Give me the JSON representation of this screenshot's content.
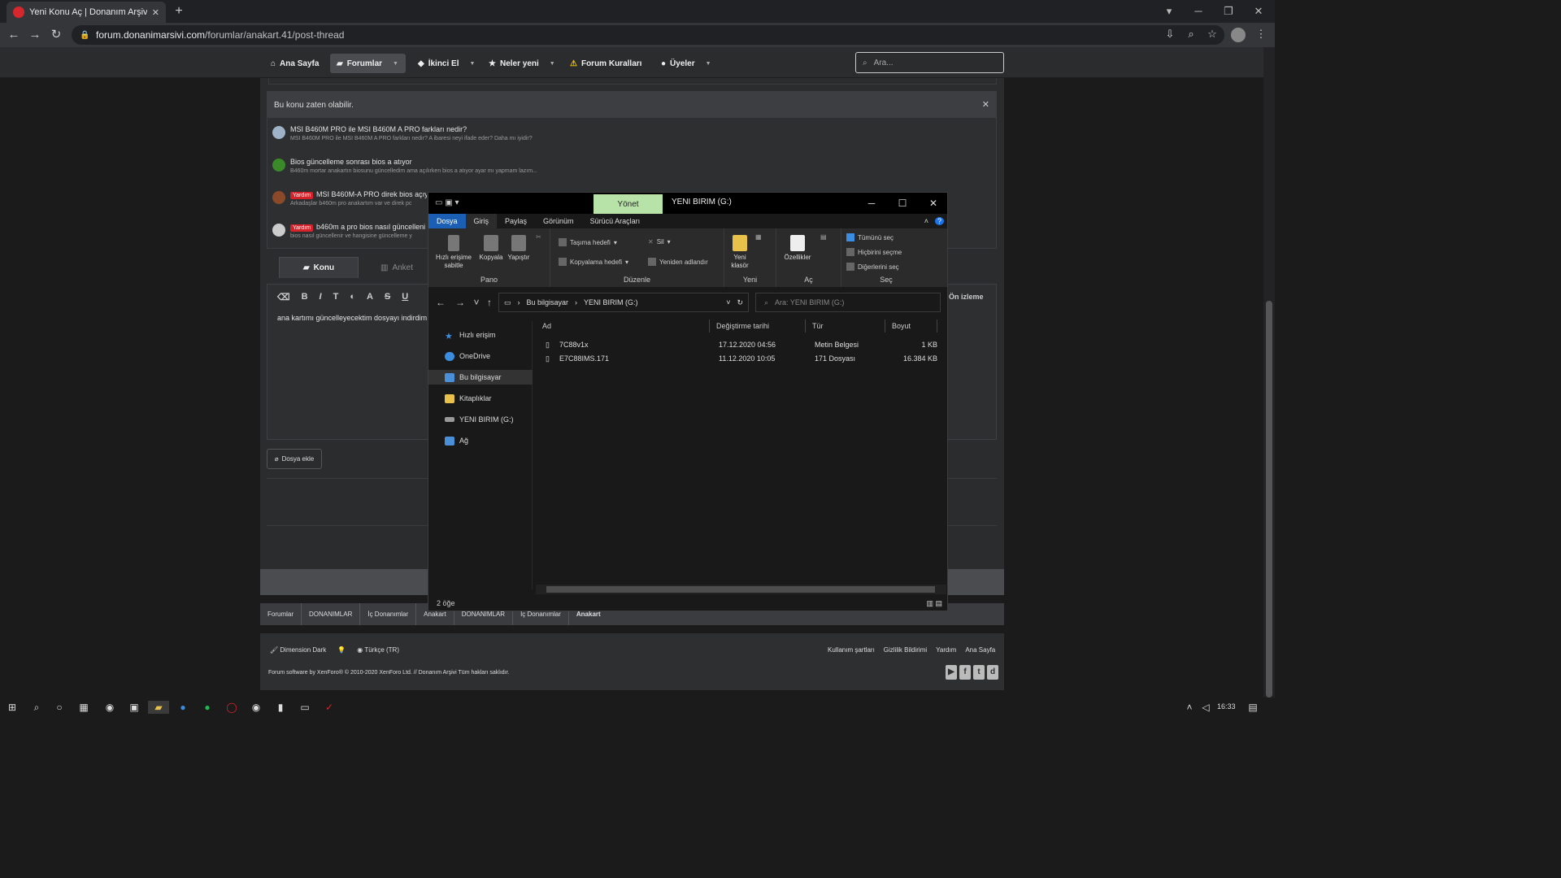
{
  "browser": {
    "tab_title": "Yeni Konu Aç | Donanım Arşivi Fo",
    "url_host": "forum.donanimarsivi.com",
    "url_path": "/forumlar/anakart.41/post-thread"
  },
  "nav": {
    "items": [
      "Ana Sayfa",
      "Forumlar",
      "İkinci El",
      "Neler yeni",
      "Forum Kuralları",
      "Üyeler"
    ],
    "search_placeholder": "Ara..."
  },
  "similar": {
    "header": "Bu konu zaten olabilir.",
    "items": [
      {
        "title": "MSI B460M PRO ile MSI B460M A PRO farkları nedir?",
        "snippet": "MSI B460M PRO ile MSI B460M A PRO farkları nedir? A ibaresi neyi ifade eder? Daha mı iyidir?",
        "badge": ""
      },
      {
        "title": "Bios güncelleme sonrası bios a atıyor",
        "snippet": "B460m mortar anakartın biosunu güncelledim ama açılırken bios a atıyor ayar mı yapmam lazım...",
        "badge": ""
      },
      {
        "title": "MSI B460M-A PRO direk bios açıy",
        "snippet": "Arkadaşlar b460m pro anakartım var ve direk pc",
        "badge": "Yardım"
      },
      {
        "title": "b460m a pro bios nasıl güncelleni",
        "snippet": "bios nasıl güncellenir ve hangisine güncelleme y",
        "badge": "Yardım"
      }
    ]
  },
  "tabs": {
    "konu": "Konu",
    "anket": "Anket"
  },
  "editor": {
    "text": "ana kartımı güncelleyecektim dosyayı indirdim",
    "preview": "Ön izleme"
  },
  "attach_label": "Dosya ekle",
  "breadcrumbs": [
    "Forumlar",
    "DONANIMLAR",
    "İç Donanımlar",
    "Anakart",
    "DONANIMLAR",
    "İç Donanımlar",
    "Anakart"
  ],
  "footer": {
    "style": "Dimension Dark",
    "lang": "Türkçe (TR)",
    "links": [
      "Kullanım şartları",
      "Gizlilik Bildirimi",
      "Yardım",
      "Ana Sayfa"
    ],
    "copyright": "Forum software by XenForo® © 2010-2020 XenForo Ltd.   //   Donanım Arşivi Tüm hakları saklıdır."
  },
  "explorer": {
    "manage_tab": "Yönet",
    "title": "YENI BIRIM (G:)",
    "ribbon_tabs": [
      "Dosya",
      "Giriş",
      "Paylaş",
      "Görünüm",
      "Sürücü Araçları"
    ],
    "ribbon": {
      "pin": "Hızlı erişime sabitle",
      "copy": "Kopyala",
      "paste": "Yapıştır",
      "move_to": "Taşıma hedefi",
      "copy_to": "Kopyalama hedefi",
      "delete": "Sil",
      "rename": "Yeniden adlandır",
      "new_folder": "Yeni klasör",
      "properties": "Özellikler",
      "select_all": "Tümünü seç",
      "select_none": "Hiçbirini seçme",
      "invert": "Diğerlerini seç"
    },
    "groups": [
      "Pano",
      "Düzenle",
      "Yeni",
      "Aç",
      "Seç"
    ],
    "path": [
      "Bu bilgisayar",
      "YENI BIRIM (G:)"
    ],
    "search_placeholder": "Ara: YENI BIRIM (G:)",
    "sidebar": [
      "Hızlı erişim",
      "OneDrive",
      "Bu bilgisayar",
      "Kitaplıklar",
      "YENI BIRIM (G:)",
      "Ağ"
    ],
    "columns": [
      "Ad",
      "Değiştirme tarihi",
      "Tür",
      "Boyut"
    ],
    "files": [
      {
        "name": "7C88v1x",
        "date": "17.12.2020 04:56",
        "type": "Metin Belgesi",
        "size": "1 KB"
      },
      {
        "name": "E7C88IMS.171",
        "date": "11.12.2020 10:05",
        "type": "171 Dosyası",
        "size": "16.384 KB"
      }
    ],
    "status": "2 öğe"
  },
  "taskbar": {
    "clock": "16:33"
  }
}
